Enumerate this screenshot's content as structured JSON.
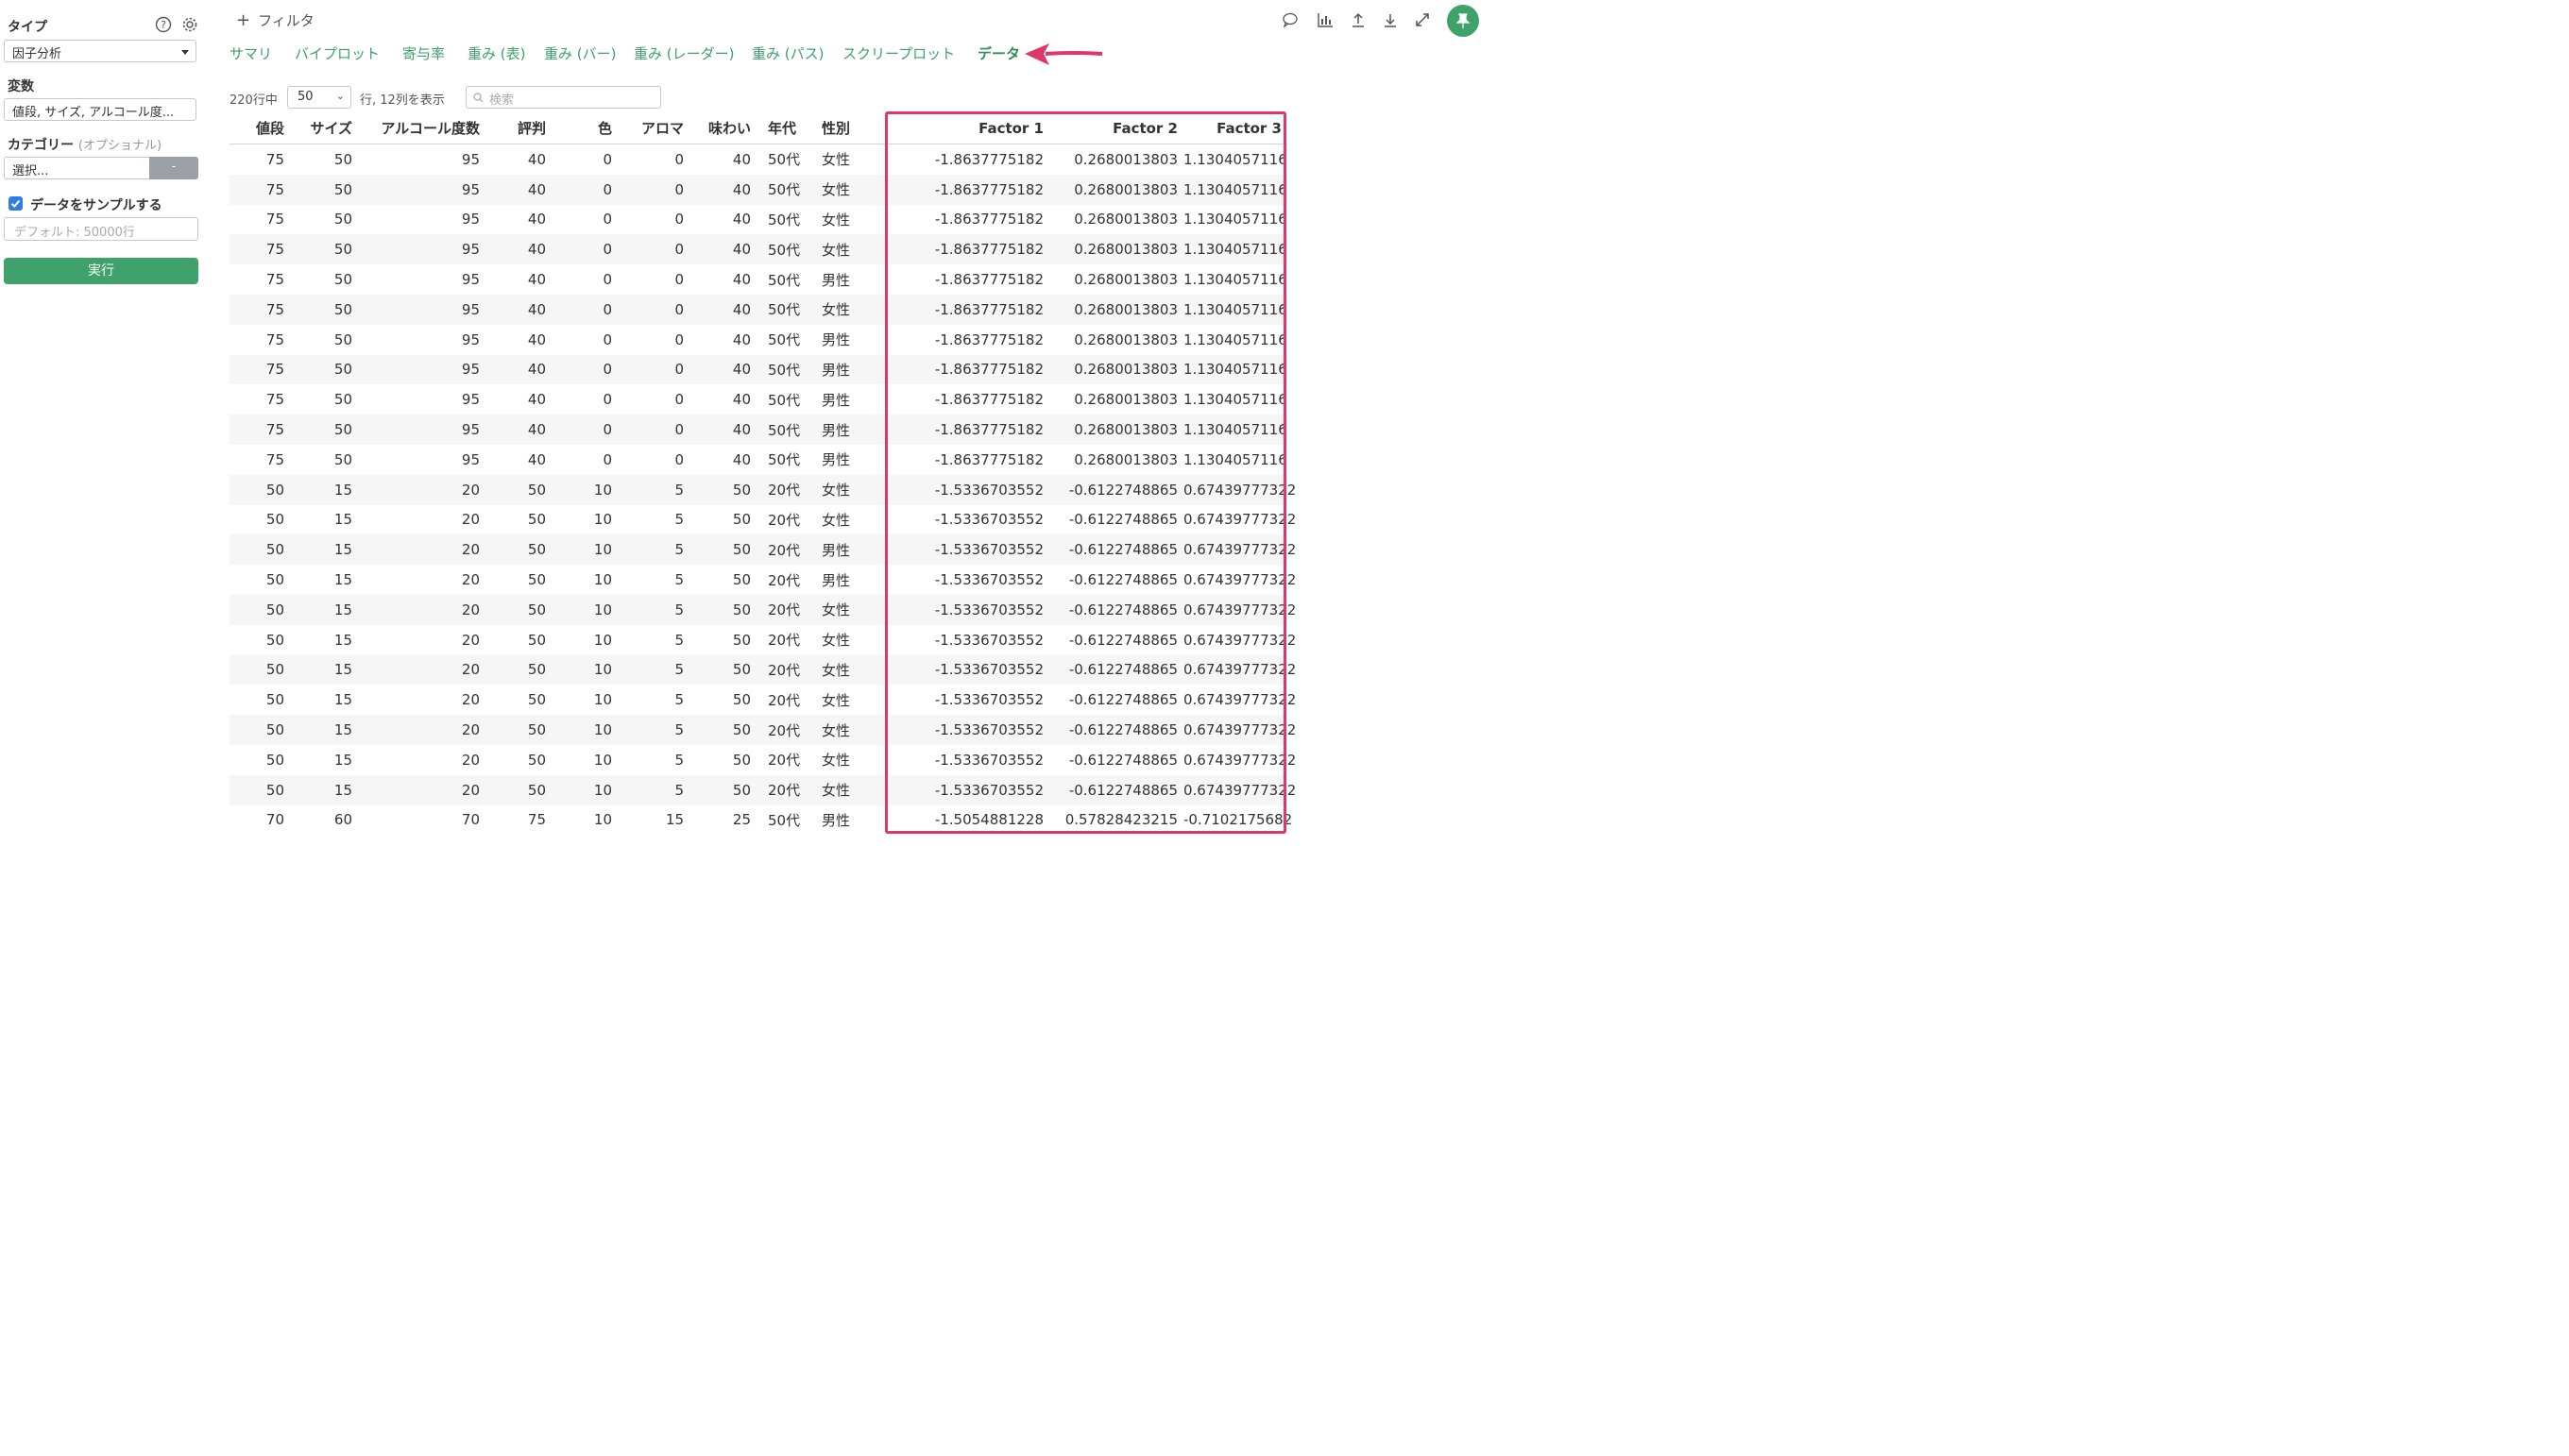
{
  "sidebar": {
    "type_label": "タイプ",
    "type_value": "因子分析",
    "variables_label": "変数",
    "variables_value": "値段, サイズ, アルコール度...",
    "category_label": "カテゴリー",
    "category_optional": "(オプショナル)",
    "category_value": "選択...",
    "category_button": "-",
    "sample_checked": true,
    "sample_label": "データをサンプルする",
    "sample_placeholder": "デフォルト: 50000行",
    "run_label": "実行"
  },
  "topbar": {
    "filter_label": "フィルタ",
    "icons": [
      "comment-icon",
      "chart-icon",
      "upload-icon",
      "download-icon",
      "expand-icon",
      "pin-icon"
    ]
  },
  "tabs": [
    {
      "label": "サマリ",
      "active": false
    },
    {
      "label": "バイプロット",
      "active": false
    },
    {
      "label": "寄与率",
      "active": false
    },
    {
      "label": "重み (表)",
      "active": false
    },
    {
      "label": "重み (バー)",
      "active": false
    },
    {
      "label": "重み (レーダー)",
      "active": false
    },
    {
      "label": "重み (パス)",
      "active": false
    },
    {
      "label": "スクリープロット",
      "active": false
    },
    {
      "label": "データ",
      "active": true
    }
  ],
  "table_controls": {
    "rows_total": "220行中",
    "page_size": "50",
    "show_info": "行, 12列を表示",
    "search_placeholder": "検索"
  },
  "colors": {
    "accent_green": "#3ea26a",
    "highlight": "#e0376b",
    "checkbox": "#2f7ee6"
  },
  "table": {
    "headers": [
      "値段",
      "サイズ",
      "アルコール度数",
      "評判",
      "色",
      "アロマ",
      "味わい",
      "年代",
      "性別",
      "Factor 1",
      "Factor 2",
      "Factor 3"
    ],
    "rows": [
      [
        "75",
        "50",
        "95",
        "40",
        "0",
        "0",
        "40",
        "50代",
        "女性",
        "-1.8637775182",
        "0.2680013803",
        "1.1304057116"
      ],
      [
        "75",
        "50",
        "95",
        "40",
        "0",
        "0",
        "40",
        "50代",
        "女性",
        "-1.8637775182",
        "0.2680013803",
        "1.1304057116"
      ],
      [
        "75",
        "50",
        "95",
        "40",
        "0",
        "0",
        "40",
        "50代",
        "女性",
        "-1.8637775182",
        "0.2680013803",
        "1.1304057116"
      ],
      [
        "75",
        "50",
        "95",
        "40",
        "0",
        "0",
        "40",
        "50代",
        "女性",
        "-1.8637775182",
        "0.2680013803",
        "1.1304057116"
      ],
      [
        "75",
        "50",
        "95",
        "40",
        "0",
        "0",
        "40",
        "50代",
        "男性",
        "-1.8637775182",
        "0.2680013803",
        "1.1304057116"
      ],
      [
        "75",
        "50",
        "95",
        "40",
        "0",
        "0",
        "40",
        "50代",
        "女性",
        "-1.8637775182",
        "0.2680013803",
        "1.1304057116"
      ],
      [
        "75",
        "50",
        "95",
        "40",
        "0",
        "0",
        "40",
        "50代",
        "男性",
        "-1.8637775182",
        "0.2680013803",
        "1.1304057116"
      ],
      [
        "75",
        "50",
        "95",
        "40",
        "0",
        "0",
        "40",
        "50代",
        "男性",
        "-1.8637775182",
        "0.2680013803",
        "1.1304057116"
      ],
      [
        "75",
        "50",
        "95",
        "40",
        "0",
        "0",
        "40",
        "50代",
        "男性",
        "-1.8637775182",
        "0.2680013803",
        "1.1304057116"
      ],
      [
        "75",
        "50",
        "95",
        "40",
        "0",
        "0",
        "40",
        "50代",
        "男性",
        "-1.8637775182",
        "0.2680013803",
        "1.1304057116"
      ],
      [
        "75",
        "50",
        "95",
        "40",
        "0",
        "0",
        "40",
        "50代",
        "男性",
        "-1.8637775182",
        "0.2680013803",
        "1.1304057116"
      ],
      [
        "50",
        "15",
        "20",
        "50",
        "10",
        "5",
        "50",
        "20代",
        "女性",
        "-1.5336703552",
        "-0.6122748865",
        "0.67439777322"
      ],
      [
        "50",
        "15",
        "20",
        "50",
        "10",
        "5",
        "50",
        "20代",
        "女性",
        "-1.5336703552",
        "-0.6122748865",
        "0.67439777322"
      ],
      [
        "50",
        "15",
        "20",
        "50",
        "10",
        "5",
        "50",
        "20代",
        "男性",
        "-1.5336703552",
        "-0.6122748865",
        "0.67439777322"
      ],
      [
        "50",
        "15",
        "20",
        "50",
        "10",
        "5",
        "50",
        "20代",
        "男性",
        "-1.5336703552",
        "-0.6122748865",
        "0.67439777322"
      ],
      [
        "50",
        "15",
        "20",
        "50",
        "10",
        "5",
        "50",
        "20代",
        "女性",
        "-1.5336703552",
        "-0.6122748865",
        "0.67439777322"
      ],
      [
        "50",
        "15",
        "20",
        "50",
        "10",
        "5",
        "50",
        "20代",
        "女性",
        "-1.5336703552",
        "-0.6122748865",
        "0.67439777322"
      ],
      [
        "50",
        "15",
        "20",
        "50",
        "10",
        "5",
        "50",
        "20代",
        "女性",
        "-1.5336703552",
        "-0.6122748865",
        "0.67439777322"
      ],
      [
        "50",
        "15",
        "20",
        "50",
        "10",
        "5",
        "50",
        "20代",
        "女性",
        "-1.5336703552",
        "-0.6122748865",
        "0.67439777322"
      ],
      [
        "50",
        "15",
        "20",
        "50",
        "10",
        "5",
        "50",
        "20代",
        "女性",
        "-1.5336703552",
        "-0.6122748865",
        "0.67439777322"
      ],
      [
        "50",
        "15",
        "20",
        "50",
        "10",
        "5",
        "50",
        "20代",
        "女性",
        "-1.5336703552",
        "-0.6122748865",
        "0.67439777322"
      ],
      [
        "50",
        "15",
        "20",
        "50",
        "10",
        "5",
        "50",
        "20代",
        "女性",
        "-1.5336703552",
        "-0.6122748865",
        "0.67439777322"
      ],
      [
        "70",
        "60",
        "70",
        "75",
        "10",
        "15",
        "25",
        "50代",
        "男性",
        "-1.5054881228",
        "0.57828423215",
        "-0.7102175682"
      ]
    ]
  }
}
